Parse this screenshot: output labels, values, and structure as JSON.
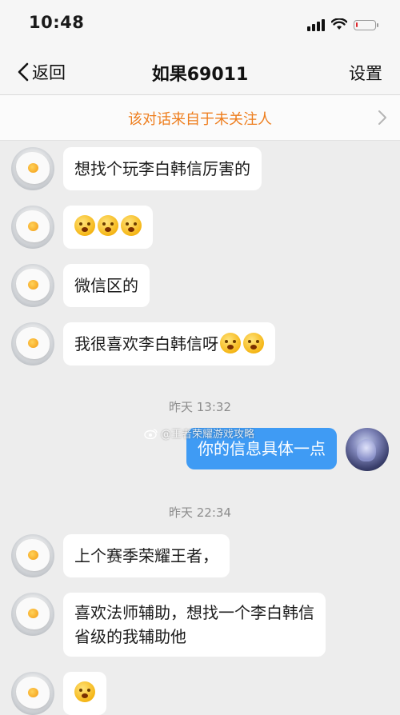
{
  "status_bar": {
    "time": "10:48",
    "battery_level": 0.1
  },
  "header": {
    "back_label": "返回",
    "title": "如果69011",
    "settings_label": "设置"
  },
  "notice": {
    "text": "该对话来自于未关注人"
  },
  "watermark": {
    "text": "@王者荣耀游戏攻略"
  },
  "messages": [
    {
      "text": "想找个玩李白韩信厉害的"
    },
    {
      "text": "",
      "emojis": [
        "scared-emoji",
        "scared-emoji",
        "scared-emoji"
      ]
    },
    {
      "text": "微信区的"
    },
    {
      "text": "我很喜欢李白韩信呀",
      "emojis": [
        "shy-emoji",
        "shy-emoji"
      ]
    },
    {
      "timestamp": "昨天 13:32"
    },
    {
      "text": "你的信息具体一点",
      "outgoing": true
    },
    {
      "timestamp": "昨天 22:34"
    },
    {
      "text": "上个赛季荣耀王者，"
    },
    {
      "line1": "喜欢法师辅助，想找一个李白韩信",
      "line2": "省级的我辅助他"
    },
    {
      "text": "",
      "emojis": [
        "emoji"
      ]
    }
  ]
}
